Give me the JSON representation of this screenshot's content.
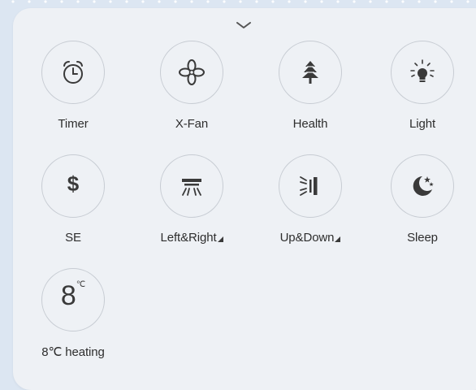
{
  "panel": {
    "collapse_icon": "chevron-down-icon"
  },
  "functions": [
    {
      "id": "timer",
      "label": "Timer",
      "icon": "alarm-clock-icon",
      "has_submenu": false
    },
    {
      "id": "xfan",
      "label": "X-Fan",
      "icon": "fan-icon",
      "has_submenu": false
    },
    {
      "id": "health",
      "label": "Health",
      "icon": "tree-icon",
      "has_submenu": false
    },
    {
      "id": "light",
      "label": "Light",
      "icon": "lightbulb-icon",
      "has_submenu": false
    },
    {
      "id": "se",
      "label": "SE",
      "icon": "dollar-icon",
      "has_submenu": false
    },
    {
      "id": "left-right",
      "label": "Left&Right",
      "icon": "swing-horizontal-icon",
      "has_submenu": true
    },
    {
      "id": "up-down",
      "label": "Up&Down",
      "icon": "swing-vertical-icon",
      "has_submenu": true
    },
    {
      "id": "sleep",
      "label": "Sleep",
      "icon": "moon-stars-icon",
      "has_submenu": false
    },
    {
      "id": "heating8",
      "label": "8℃ heating",
      "icon": "8c-icon",
      "has_submenu": false
    }
  ],
  "icon_text": {
    "se": "$",
    "heating8_big": "8",
    "heating8_small": "℃"
  },
  "colors": {
    "background": "#dce6f2",
    "panel": "#eef1f5",
    "icon": "#3a3a3a",
    "circle_border": "#c7ccd3"
  }
}
